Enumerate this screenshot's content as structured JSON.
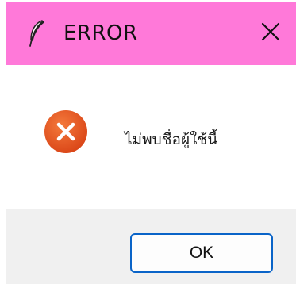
{
  "window": {
    "title": "ERROR",
    "app_icon": "feather-icon",
    "close_icon": "close-icon"
  },
  "dialog": {
    "icon": "error-x-icon",
    "message": "ไม่พบชื่อผู้ใช้นี้"
  },
  "buttons": {
    "ok_label": "OK"
  },
  "colors": {
    "title_bar": "#ff79d9",
    "error_icon": "#e4561f",
    "ok_border": "#0a64c8"
  }
}
